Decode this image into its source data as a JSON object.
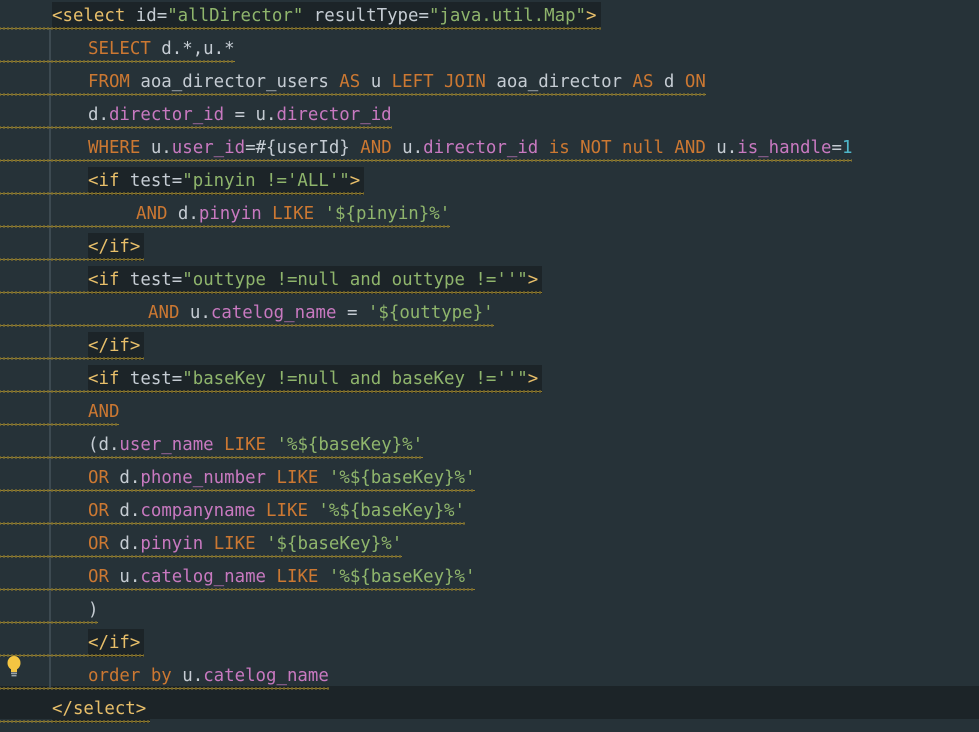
{
  "editor": {
    "lines": [
      {
        "indent": 52,
        "hl": true,
        "segments": [
          [
            "tag",
            "<select"
          ],
          [
            "attr",
            " id="
          ],
          [
            "str",
            "\"allDirector\""
          ],
          [
            "attr",
            " resultType="
          ],
          [
            "str",
            "\"java.util.Map\""
          ],
          [
            "tag",
            ">"
          ]
        ]
      },
      {
        "indent": 88,
        "segments": [
          [
            "kw",
            "SELECT"
          ],
          [
            "pl",
            " d.*,u.*"
          ]
        ]
      },
      {
        "indent": 88,
        "segments": [
          [
            "kw",
            "FROM"
          ],
          [
            "pl",
            " aoa_director_users "
          ],
          [
            "kw",
            "AS"
          ],
          [
            "pl",
            " u "
          ],
          [
            "kw",
            "LEFT JOIN"
          ],
          [
            "pl",
            " aoa_director "
          ],
          [
            "kw",
            "AS"
          ],
          [
            "pl",
            " d "
          ],
          [
            "kw",
            "ON"
          ]
        ]
      },
      {
        "indent": 88,
        "segments": [
          [
            "pl",
            "d."
          ],
          [
            "fld",
            "director_id"
          ],
          [
            "pl",
            " = u."
          ],
          [
            "fld",
            "director_id"
          ]
        ]
      },
      {
        "indent": 88,
        "segments": [
          [
            "kw",
            "WHERE"
          ],
          [
            "pl",
            " u."
          ],
          [
            "fld",
            "user_id"
          ],
          [
            "pl",
            "=#{userId} "
          ],
          [
            "kw",
            "AND"
          ],
          [
            "pl",
            " u."
          ],
          [
            "fld",
            "director_id"
          ],
          [
            "pl",
            " "
          ],
          [
            "kw",
            "is NOT null AND"
          ],
          [
            "pl",
            " u."
          ],
          [
            "fld",
            "is_handle"
          ],
          [
            "pl",
            "="
          ],
          [
            "num",
            "1"
          ]
        ]
      },
      {
        "indent": 88,
        "hl": true,
        "segments": [
          [
            "tag",
            "<if"
          ],
          [
            "attr",
            " test="
          ],
          [
            "str",
            "\"pinyin !='ALL'\""
          ],
          [
            "tag",
            ">"
          ]
        ]
      },
      {
        "indent": 136,
        "segments": [
          [
            "kw",
            "AND"
          ],
          [
            "pl",
            " d."
          ],
          [
            "fld",
            "pinyin"
          ],
          [
            "pl",
            " "
          ],
          [
            "kw",
            "LIKE"
          ],
          [
            "pl",
            " "
          ],
          [
            "str",
            "'${pinyin}%'"
          ]
        ]
      },
      {
        "indent": 88,
        "hl": true,
        "segments": [
          [
            "tag",
            "</if>"
          ]
        ]
      },
      {
        "indent": 88,
        "hl": true,
        "segments": [
          [
            "tag",
            "<if"
          ],
          [
            "attr",
            " test="
          ],
          [
            "str",
            "\"outtype !=null and outtype !=''\""
          ],
          [
            "tag",
            ">"
          ]
        ]
      },
      {
        "indent": 148,
        "segments": [
          [
            "kw",
            "AND"
          ],
          [
            "pl",
            " u."
          ],
          [
            "fld",
            "catelog_name"
          ],
          [
            "pl",
            " = "
          ],
          [
            "str",
            "'${outtype}'"
          ]
        ]
      },
      {
        "indent": 88,
        "hl": true,
        "segments": [
          [
            "tag",
            "</if>"
          ]
        ]
      },
      {
        "indent": 88,
        "hl": true,
        "segments": [
          [
            "tag",
            "<if"
          ],
          [
            "attr",
            " test="
          ],
          [
            "str",
            "\"baseKey !=null and baseKey !=''\""
          ],
          [
            "tag",
            ">"
          ]
        ]
      },
      {
        "indent": 88,
        "segments": [
          [
            "kw",
            "AND"
          ]
        ]
      },
      {
        "indent": 88,
        "segments": [
          [
            "pl",
            "(d."
          ],
          [
            "fld",
            "user_name"
          ],
          [
            "pl",
            " "
          ],
          [
            "kw",
            "LIKE"
          ],
          [
            "pl",
            " "
          ],
          [
            "str",
            "'%${baseKey}%'"
          ]
        ]
      },
      {
        "indent": 88,
        "segments": [
          [
            "kw",
            "OR"
          ],
          [
            "pl",
            " d."
          ],
          [
            "fld",
            "phone_number"
          ],
          [
            "pl",
            " "
          ],
          [
            "kw",
            "LIKE"
          ],
          [
            "pl",
            " "
          ],
          [
            "str",
            "'%${baseKey}%'"
          ]
        ]
      },
      {
        "indent": 88,
        "segments": [
          [
            "kw",
            "OR"
          ],
          [
            "pl",
            " d."
          ],
          [
            "fld",
            "companyname"
          ],
          [
            "pl",
            " "
          ],
          [
            "kw",
            "LIKE"
          ],
          [
            "pl",
            " "
          ],
          [
            "str",
            "'%${baseKey}%'"
          ]
        ]
      },
      {
        "indent": 88,
        "segments": [
          [
            "kw",
            "OR"
          ],
          [
            "pl",
            " d."
          ],
          [
            "fld",
            "pinyin"
          ],
          [
            "pl",
            " "
          ],
          [
            "kw",
            "LIKE"
          ],
          [
            "pl",
            " "
          ],
          [
            "str",
            "'${baseKey}%'"
          ]
        ]
      },
      {
        "indent": 88,
        "segments": [
          [
            "kw",
            "OR"
          ],
          [
            "pl",
            " u."
          ],
          [
            "fld",
            "catelog_name"
          ],
          [
            "pl",
            " "
          ],
          [
            "kw",
            "LIKE"
          ],
          [
            "pl",
            " "
          ],
          [
            "str",
            "'%${baseKey}%'"
          ]
        ]
      },
      {
        "indent": 88,
        "segments": [
          [
            "pl",
            ")"
          ]
        ]
      },
      {
        "indent": 88,
        "hl": true,
        "segments": [
          [
            "tag",
            "</if>"
          ]
        ]
      },
      {
        "indent": 88,
        "segments": [
          [
            "kw",
            "order by"
          ],
          [
            "pl",
            " u."
          ],
          [
            "fld",
            "catelog_name"
          ]
        ]
      },
      {
        "indent": 52,
        "hl": true,
        "segments": [
          [
            "tag",
            "</select>"
          ]
        ]
      }
    ]
  },
  "colors": {
    "background": "#263238",
    "tag": "#e8bf6a",
    "string": "#8fb56c",
    "keyword": "#cc7832",
    "field": "#c879c0",
    "number": "#4fb6c9",
    "warning_squiggle": "#a68b2d"
  },
  "icons": {
    "intention": "lightbulb-icon"
  }
}
